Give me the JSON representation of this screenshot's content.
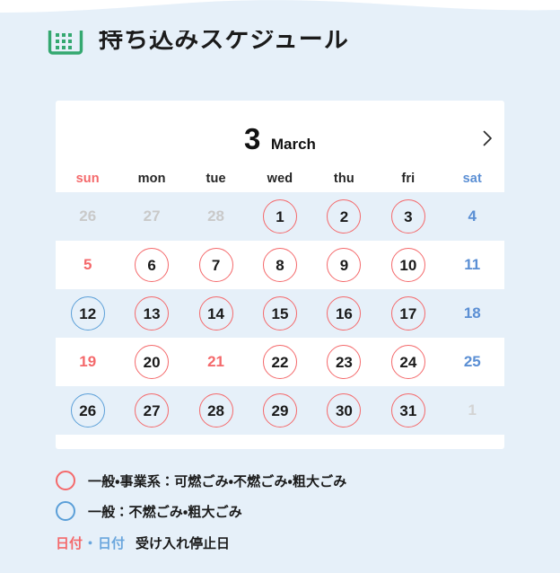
{
  "theme": {
    "bg": "#e6f0f9",
    "card_bg": "#ffffff",
    "accent_green": "#34a870",
    "red": "#f4696b",
    "blue": "#5b9fd8",
    "sat_blue": "#5b8fd4",
    "muted": "#c9c9c9"
  },
  "header": {
    "icon": "calendar-icon",
    "title": "持ち込みスケジュール"
  },
  "calendar": {
    "month_number": "3",
    "month_name": "March",
    "next_label": "›",
    "weekdays": [
      {
        "label": "sun",
        "kind": "sun"
      },
      {
        "label": "mon",
        "kind": "weekday"
      },
      {
        "label": "tue",
        "kind": "weekday"
      },
      {
        "label": "wed",
        "kind": "weekday"
      },
      {
        "label": "thu",
        "kind": "weekday"
      },
      {
        "label": "fri",
        "kind": "weekday"
      },
      {
        "label": "sat",
        "kind": "sat"
      }
    ],
    "weeks": [
      {
        "tinted": true,
        "days": [
          {
            "n": "26",
            "state": "other"
          },
          {
            "n": "27",
            "state": "other"
          },
          {
            "n": "28",
            "state": "other"
          },
          {
            "n": "1",
            "state": "mark-red"
          },
          {
            "n": "2",
            "state": "mark-red"
          },
          {
            "n": "3",
            "state": "mark-red"
          },
          {
            "n": "4",
            "state": "txt-blue"
          }
        ]
      },
      {
        "tinted": false,
        "days": [
          {
            "n": "5",
            "state": "txt-red"
          },
          {
            "n": "6",
            "state": "mark-red"
          },
          {
            "n": "7",
            "state": "mark-red"
          },
          {
            "n": "8",
            "state": "mark-red"
          },
          {
            "n": "9",
            "state": "mark-red"
          },
          {
            "n": "10",
            "state": "mark-red"
          },
          {
            "n": "11",
            "state": "txt-blue"
          }
        ]
      },
      {
        "tinted": true,
        "days": [
          {
            "n": "12",
            "state": "mark-blue"
          },
          {
            "n": "13",
            "state": "mark-red"
          },
          {
            "n": "14",
            "state": "mark-red"
          },
          {
            "n": "15",
            "state": "mark-red"
          },
          {
            "n": "16",
            "state": "mark-red"
          },
          {
            "n": "17",
            "state": "mark-red"
          },
          {
            "n": "18",
            "state": "txt-blue"
          }
        ]
      },
      {
        "tinted": false,
        "days": [
          {
            "n": "19",
            "state": "txt-red"
          },
          {
            "n": "20",
            "state": "mark-red"
          },
          {
            "n": "21",
            "state": "txt-red"
          },
          {
            "n": "22",
            "state": "mark-red"
          },
          {
            "n": "23",
            "state": "mark-red"
          },
          {
            "n": "24",
            "state": "mark-red"
          },
          {
            "n": "25",
            "state": "txt-blue"
          }
        ]
      },
      {
        "tinted": true,
        "days": [
          {
            "n": "26",
            "state": "mark-blue"
          },
          {
            "n": "27",
            "state": "mark-red"
          },
          {
            "n": "28",
            "state": "mark-red"
          },
          {
            "n": "29",
            "state": "mark-red"
          },
          {
            "n": "30",
            "state": "mark-red"
          },
          {
            "n": "31",
            "state": "mark-red"
          },
          {
            "n": "1",
            "state": "other dim"
          }
        ]
      }
    ]
  },
  "legend": {
    "items": [
      {
        "marker": "red-circle",
        "text": "一般・事業系：可燃ごみ・不燃ごみ・粗大ごみ"
      },
      {
        "marker": "blue-circle",
        "text": "一般：不燃ごみ・粗大ごみ"
      }
    ],
    "closed": {
      "red_date": "日付",
      "separator": "・",
      "blue_date": "日付",
      "label": "受け入れ停止日"
    }
  }
}
